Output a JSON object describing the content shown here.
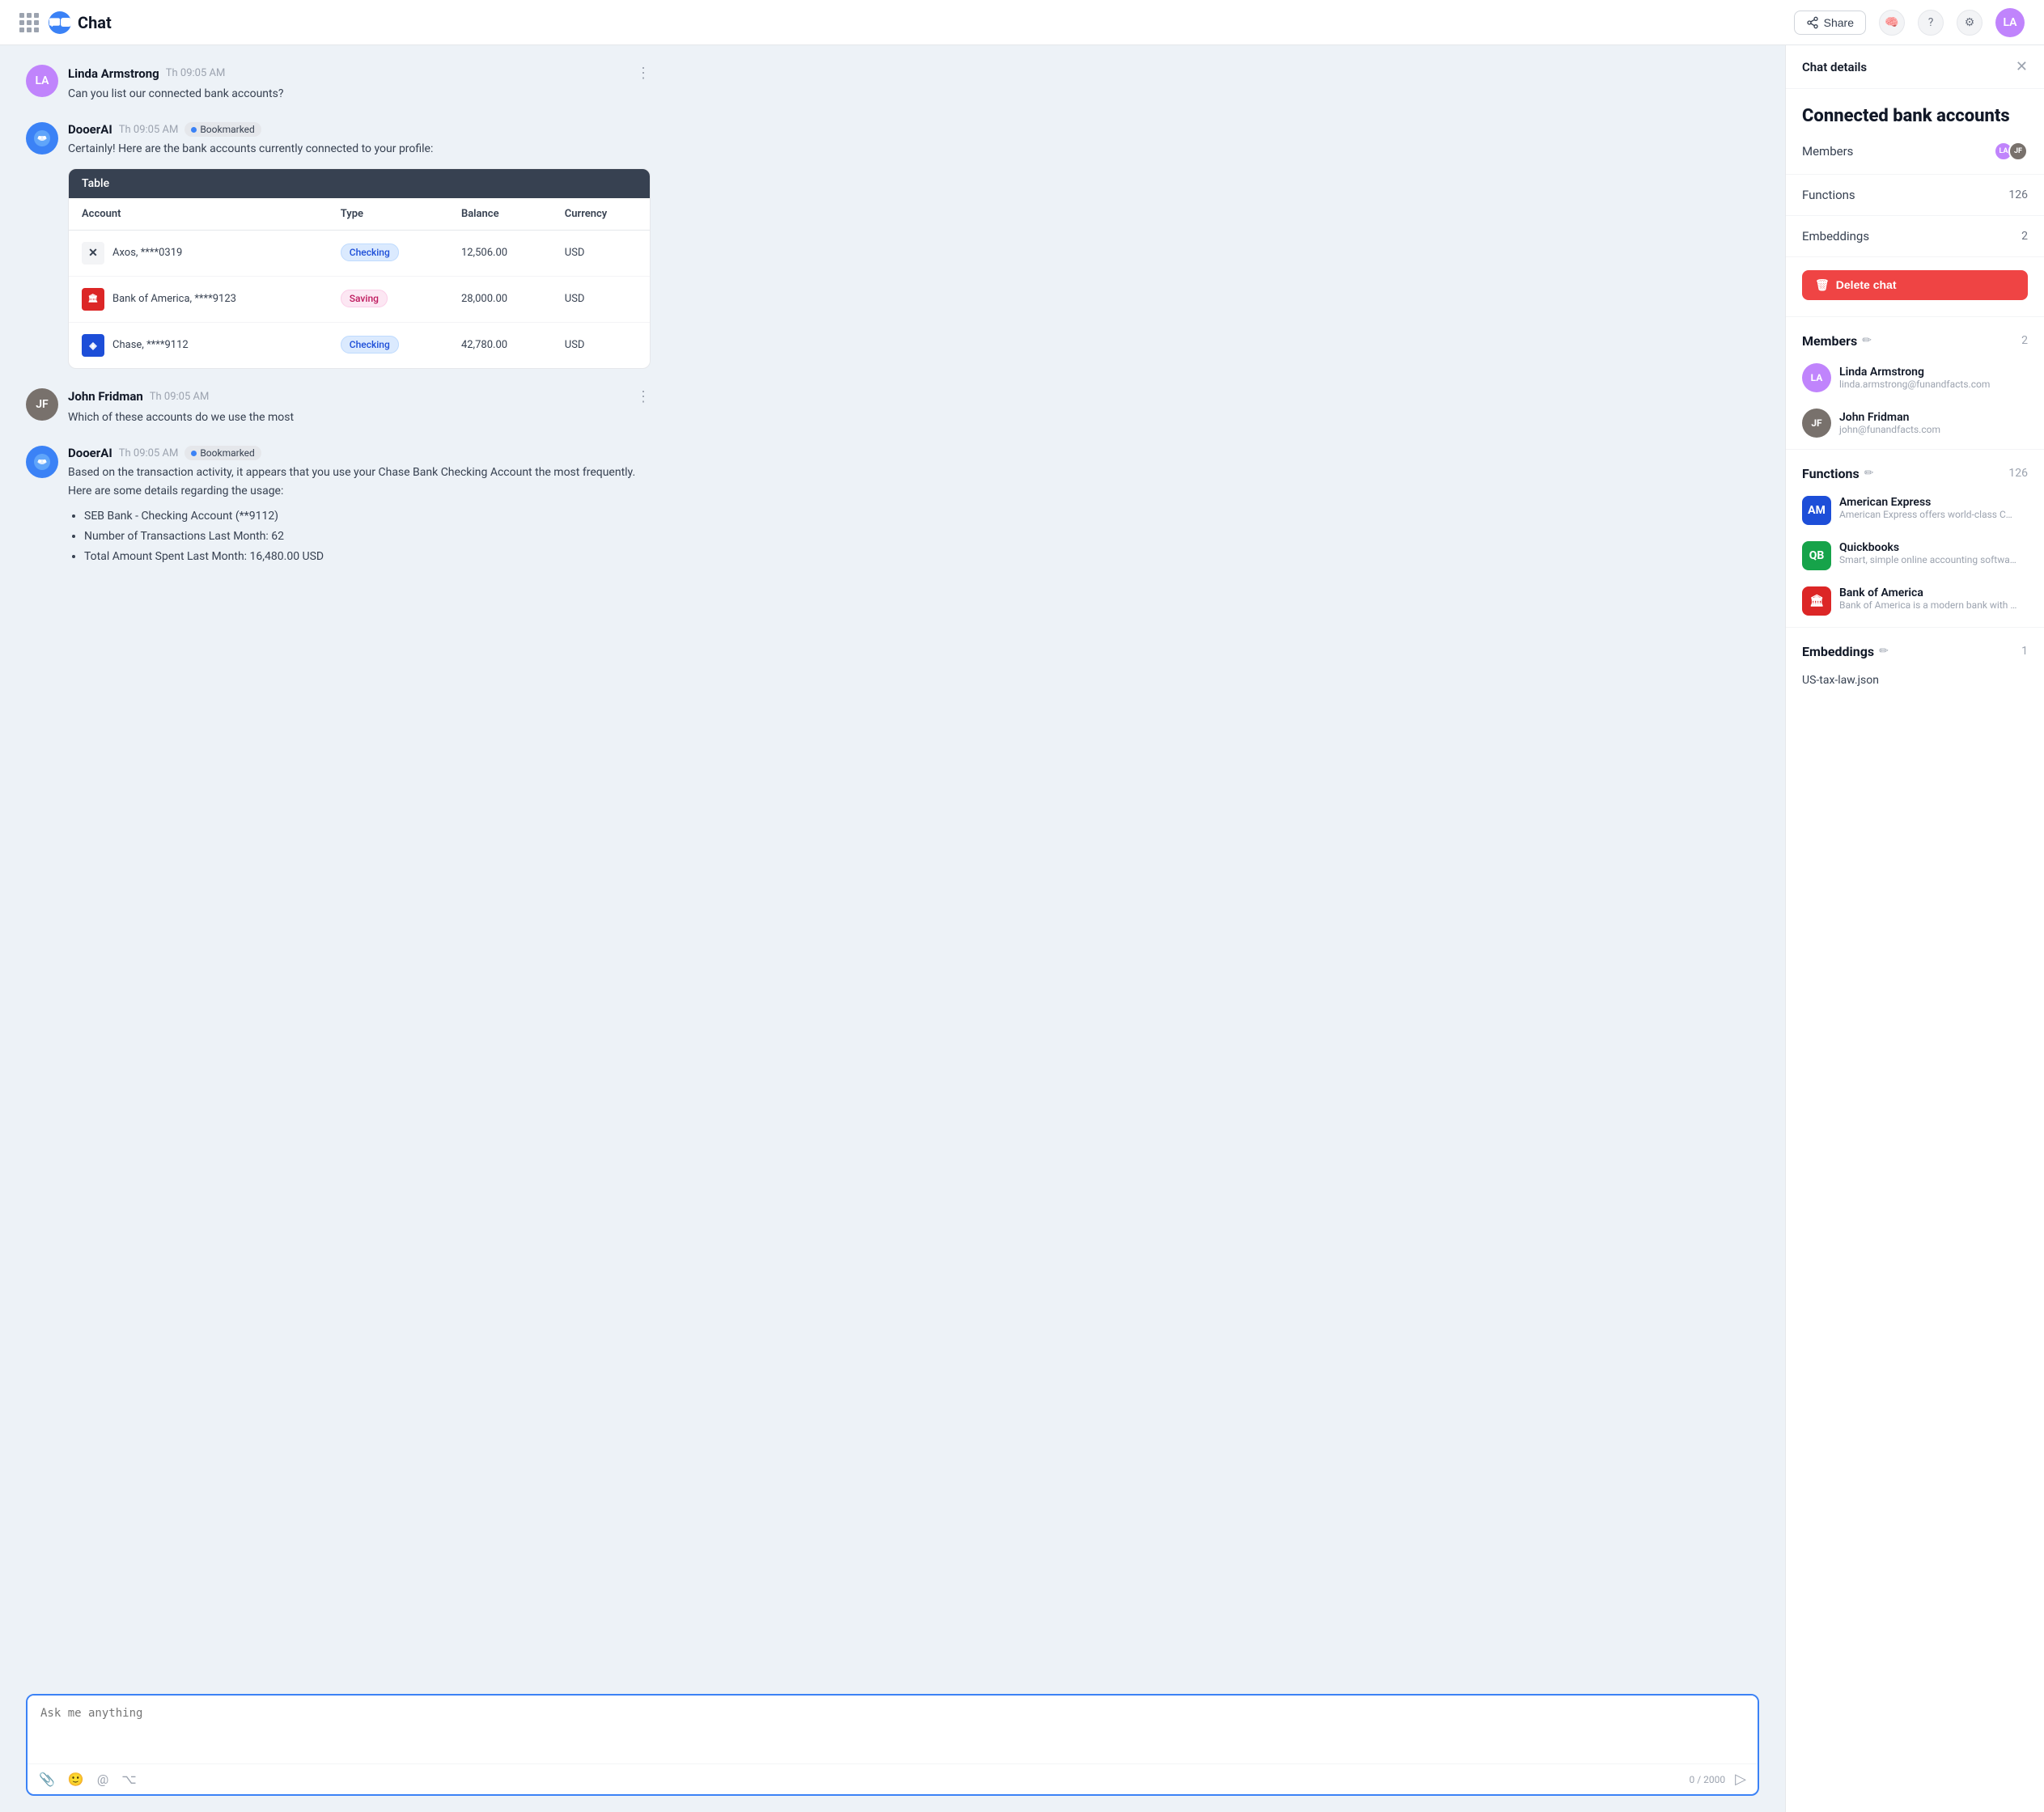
{
  "topbar": {
    "app_title": "Chat",
    "share_label": "Share",
    "help_icon": "?",
    "grid_icon": "grid"
  },
  "chat": {
    "messages": [
      {
        "id": "msg1",
        "sender": "Linda Armstrong",
        "time": "Th 09:05 AM",
        "text": "Can you list our connected bank accounts?",
        "type": "user",
        "avatar_initials": "LA",
        "avatar_bg": "#c084fc"
      },
      {
        "id": "msg2",
        "sender": "DooerAI",
        "time": "Th 09:05 AM",
        "badge": "Bookmarked",
        "text": "Certainly! Here are the bank accounts currently connected to your profile:",
        "type": "ai",
        "has_table": true
      },
      {
        "id": "msg3",
        "sender": "John Fridman",
        "time": "Th 09:05 AM",
        "text": "Which of these accounts do we use the most",
        "type": "user",
        "avatar_initials": "JF",
        "avatar_bg": "#78716c"
      },
      {
        "id": "msg4",
        "sender": "DooerAI",
        "time": "Th 09:05 AM",
        "badge": "Bookmarked",
        "text": "Based on the transaction activity, it appears that you use your Chase Bank Checking Account the most frequently. Here are some details regarding the usage:",
        "type": "ai",
        "has_bullets": true,
        "bullets": [
          "SEB Bank - Checking Account (**9112)",
          "Number of Transactions Last Month: 62",
          "Total Amount Spent Last Month: 16,480.00 USD"
        ]
      }
    ],
    "table": {
      "label": "Table",
      "columns": [
        "Account",
        "Type",
        "Balance",
        "Currency"
      ],
      "rows": [
        {
          "bank": "Axos, ****0319",
          "bank_icon_color": "#e5e7eb",
          "bank_icon_text": "✕",
          "type": "Checking",
          "type_class": "checking",
          "balance": "12,506.00",
          "currency": "USD"
        },
        {
          "bank": "Bank of America, ****9123",
          "bank_icon_color": "#dc2626",
          "bank_icon_text": "🏛",
          "type": "Saving",
          "type_class": "saving",
          "balance": "28,000.00",
          "currency": "USD"
        },
        {
          "bank": "Chase, ****9112",
          "bank_icon_color": "#1d4ed8",
          "bank_icon_text": "⬡",
          "type": "Checking",
          "type_class": "checking",
          "balance": "42,780.00",
          "currency": "USD"
        }
      ]
    },
    "input_placeholder": "Ask me anything",
    "char_count": "0 / 2000"
  },
  "panel": {
    "title": "Chat details",
    "section_title": "Connected bank accounts",
    "rows": [
      {
        "label": "Members",
        "count": ""
      },
      {
        "label": "Functions",
        "count": "126"
      },
      {
        "label": "Embeddings",
        "count": "2"
      }
    ],
    "delete_label": "Delete chat",
    "members_section": "Members",
    "members_count": "2",
    "members": [
      {
        "name": "Linda Armstrong",
        "email": "linda.armstrong@funandfacts.com",
        "initials": "LA",
        "bg": "#c084fc"
      },
      {
        "name": "John Fridman",
        "email": "john@funandfacts.com",
        "initials": "JF",
        "bg": "#78716c"
      }
    ],
    "functions_section": "Functions",
    "functions_count": "126",
    "functions": [
      {
        "name": "American Express",
        "desc": "American Express offers world-class Char...",
        "icon_text": "AM",
        "icon_bg": "#1d4ed8"
      },
      {
        "name": "Quickbooks",
        "desc": "Smart, simple online accounting software...",
        "icon_text": "QB",
        "icon_bg": "#22c55e"
      },
      {
        "name": "Bank of America",
        "desc": "Bank of America is a modern bank with its...",
        "icon_text": "🏛",
        "icon_bg": "#dc2626"
      }
    ],
    "embeddings_section": "Embeddings",
    "embeddings_count": "1",
    "embeddings": [
      "US-tax-law.json"
    ]
  }
}
